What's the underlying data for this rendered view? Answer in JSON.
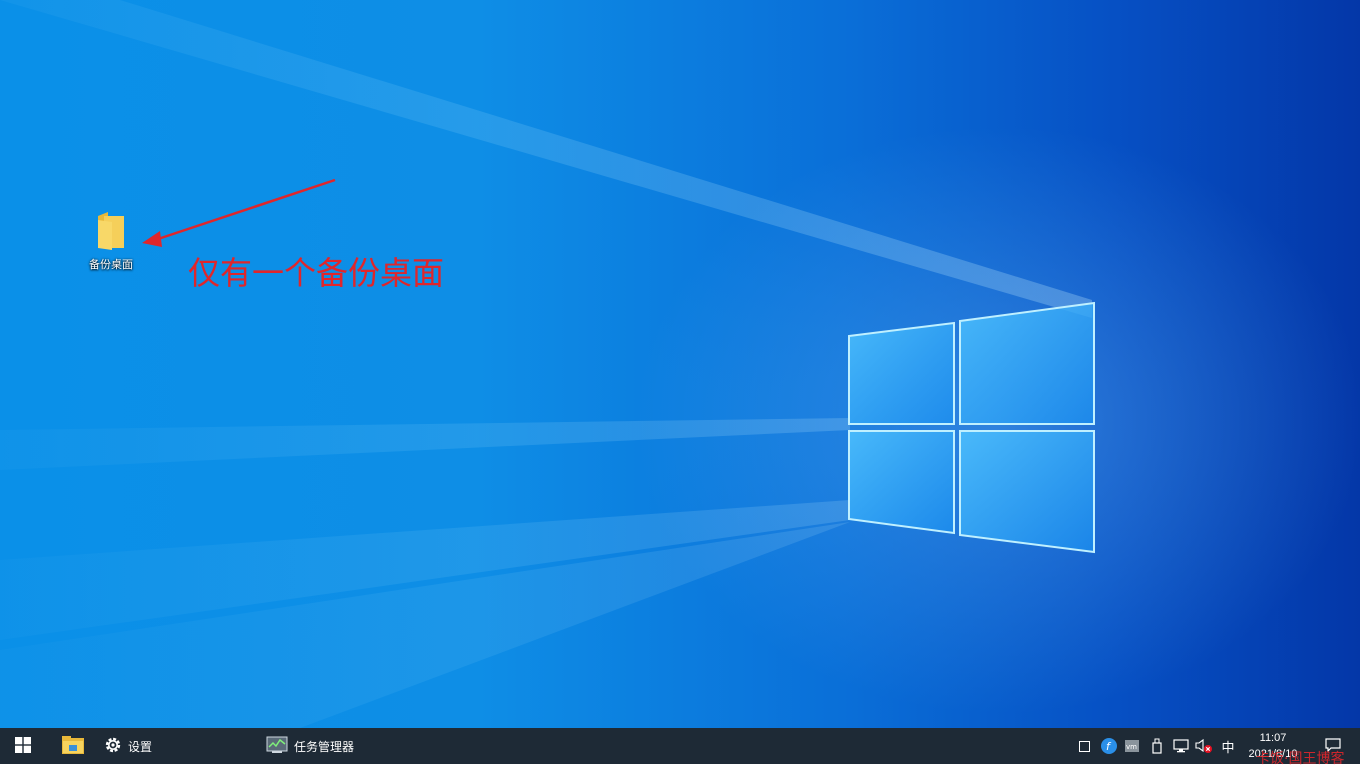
{
  "desktop": {
    "icons": [
      {
        "label": "备份桌面",
        "icon": "folder-icon"
      }
    ],
    "annotation": "仅有一个备份桌面",
    "annotation_color": "#e0262b"
  },
  "taskbar": {
    "start_icon": "windows-logo-icon",
    "pinned": [
      {
        "icon": "file-explorer-icon",
        "label": ""
      },
      {
        "icon": "gear-icon",
        "label": "设置"
      },
      {
        "icon": "task-manager-icon",
        "label": "任务管理器"
      }
    ],
    "tray": {
      "ime": "中",
      "time": "11:07",
      "date": "2021/8/10"
    }
  },
  "watermark": "卡饭·国王博客"
}
